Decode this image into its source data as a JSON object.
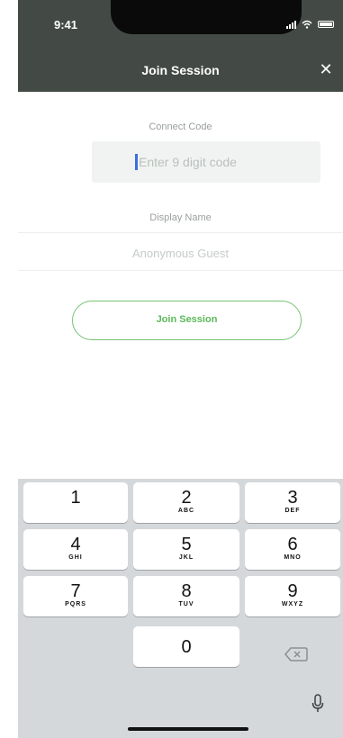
{
  "status": {
    "time": "9:41"
  },
  "header": {
    "title": "Join Session",
    "close_label": "✕"
  },
  "form": {
    "connect_code_label": "Connect Code",
    "connect_code_placeholder": "Enter 9 digit code",
    "connect_code_value": "",
    "display_name_label": "Display Name",
    "display_name_placeholder": "Anonymous Guest",
    "display_name_value": "",
    "join_button_label": "Join Session"
  },
  "keypad": {
    "keys": [
      {
        "digit": "1",
        "letters": ""
      },
      {
        "digit": "2",
        "letters": "ABC"
      },
      {
        "digit": "3",
        "letters": "DEF"
      },
      {
        "digit": "4",
        "letters": "GHI"
      },
      {
        "digit": "5",
        "letters": "JKL"
      },
      {
        "digit": "6",
        "letters": "MNO"
      },
      {
        "digit": "7",
        "letters": "PQRS"
      },
      {
        "digit": "8",
        "letters": "TUV"
      },
      {
        "digit": "9",
        "letters": "WXYZ"
      },
      {
        "digit": "0",
        "letters": ""
      }
    ],
    "backspace_icon": "backspace-icon",
    "mic_icon": "microphone-icon"
  },
  "colors": {
    "header_bg": "#434a46",
    "accent_green": "#5bb95a",
    "caret": "#3b6ee0",
    "keyboard_bg": "#d5d8db"
  }
}
